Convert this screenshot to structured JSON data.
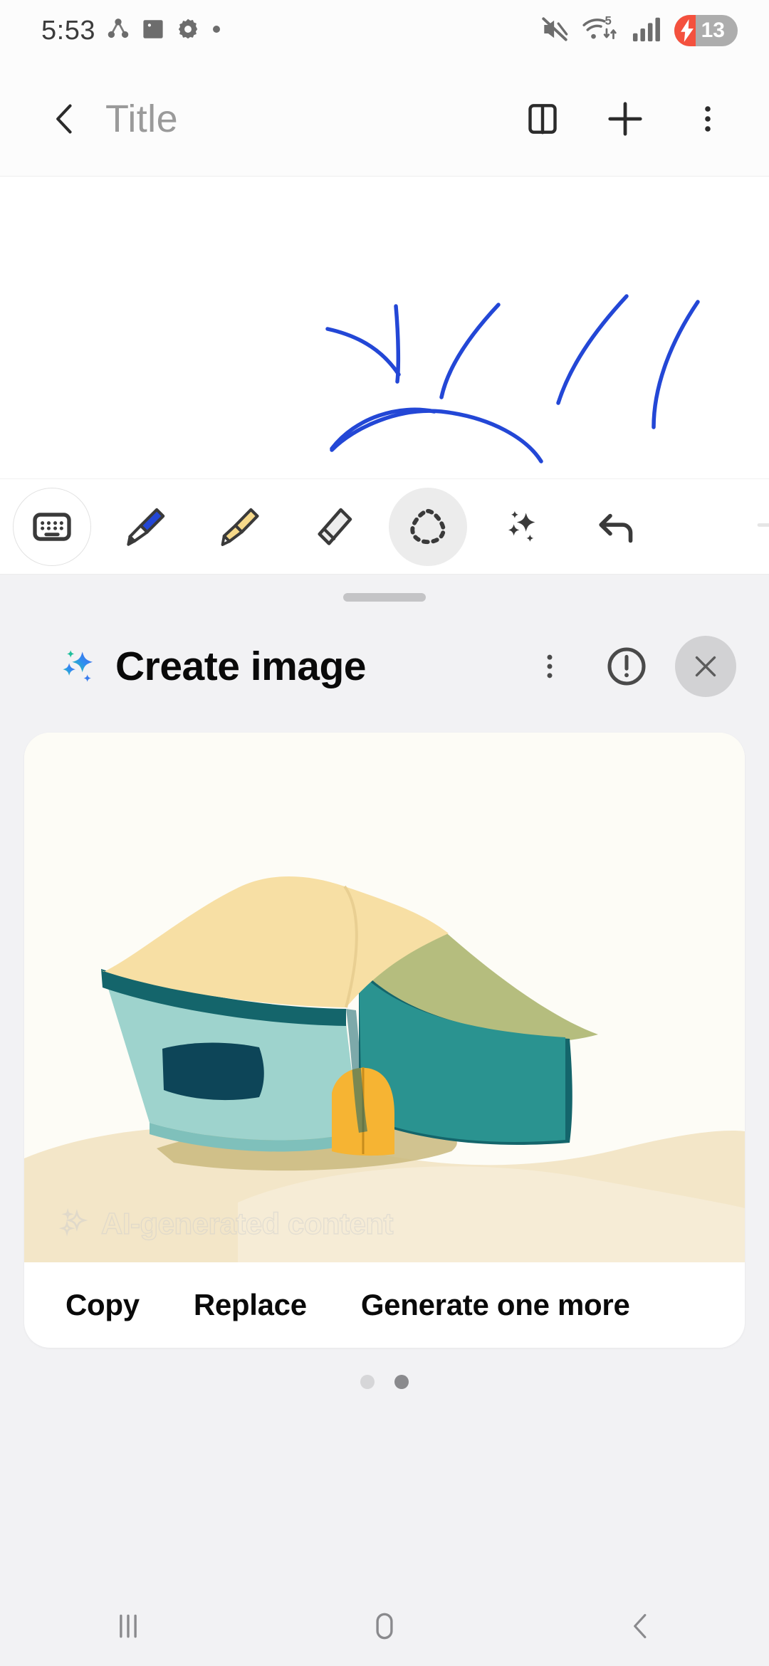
{
  "status_bar": {
    "clock": "5:53",
    "left_icons": [
      "share-triangle-icon",
      "gallery-icon",
      "settings-gear-icon",
      "dot-indicator-icon"
    ],
    "mute_icon": "mute-icon",
    "wifi_icon": "wifi-icon",
    "wifi_badge": "5",
    "signal_icon": "cellular-signal-icon",
    "battery_level": "13",
    "battery_charging": true,
    "battery_fill_color": "#f4513e",
    "battery_track_color": "#adadad"
  },
  "app_bar": {
    "back_icon": "back-chevron-icon",
    "title": "Title",
    "title_color": "#9a9a9a",
    "reading_mode_icon": "book-icon",
    "add_icon": "plus-icon",
    "more_icon": "more-vertical-icon"
  },
  "canvas": {
    "stroke_color": "#2347d6",
    "description": "blue hand-drawn sun sketch"
  },
  "toolbar": {
    "tools": [
      {
        "name": "keyboard-tool",
        "icon": "keyboard-icon",
        "state": "ringed"
      },
      {
        "name": "pen-tool",
        "icon": "pen-icon",
        "color": "#2347d6",
        "state": "normal"
      },
      {
        "name": "highlighter-tool",
        "icon": "highlighter-icon",
        "color": "#f6d98a",
        "state": "normal"
      },
      {
        "name": "eraser-tool",
        "icon": "eraser-icon",
        "color": "#e8e8e8",
        "state": "normal"
      },
      {
        "name": "selection-tool",
        "icon": "lasso-select-icon",
        "state": "active"
      },
      {
        "name": "ai-tool",
        "icon": "sparkle-icon",
        "state": "normal"
      },
      {
        "name": "undo-tool",
        "icon": "undo-arrow-icon",
        "state": "normal"
      },
      {
        "name": "redo-tool",
        "icon": "redo-arrow-icon",
        "state": "clipped"
      }
    ]
  },
  "sheet": {
    "handle": "drag-handle",
    "sparkle_icon": "ai-sparkle-icon",
    "title": "Create image",
    "more_icon": "more-vertical-icon",
    "info_icon": "info-exclamation-icon",
    "close_icon": "close-x-icon",
    "background": "#f2f2f4"
  },
  "image_card": {
    "watermark_text": "AI-generated content",
    "watermark_icon": "sparkle-outline-icon",
    "image_background": "#fdfcf6",
    "palette": {
      "roof_light": "#f7dfa4",
      "roof_shadow": "#b5bd7e",
      "wall_light": "#9ed3cd",
      "wall_mid": "#2a9390",
      "wall_dark": "#14656b",
      "window_dark": "#0d4558",
      "door": "#f6b433",
      "sand_light": "#f3e6c8",
      "sand_shadow": "#c9b97e"
    },
    "actions": [
      {
        "name": "copy-button",
        "label": "Copy"
      },
      {
        "name": "replace-button",
        "label": "Replace"
      },
      {
        "name": "generate-one-more-button",
        "label": "Generate one more"
      }
    ]
  },
  "page_indicator": {
    "total": 2,
    "active_index": 1
  },
  "nav_bar": {
    "recents_icon": "recents-icon",
    "home_icon": "home-icon",
    "back_icon": "back-chevron-icon"
  }
}
